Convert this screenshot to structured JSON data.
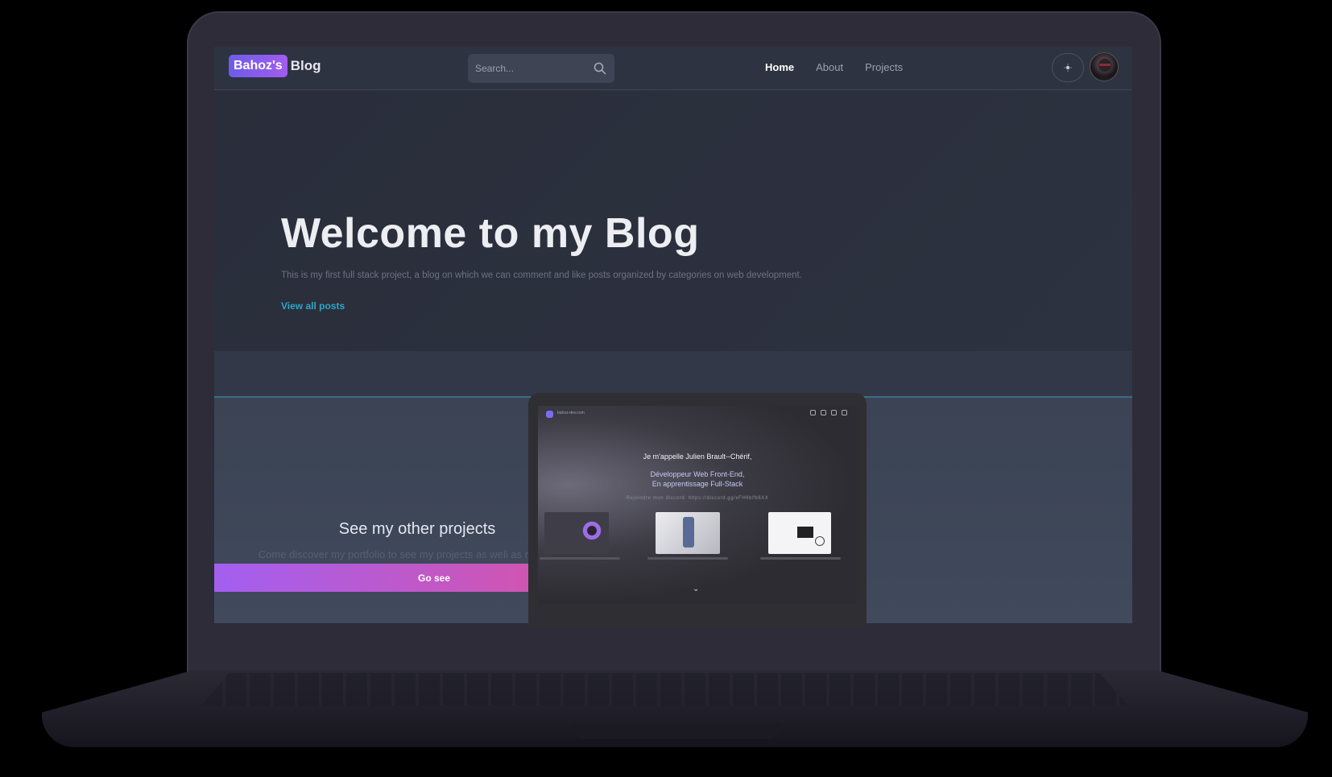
{
  "brand": {
    "badge": "Bahoz's",
    "text": "Blog"
  },
  "search": {
    "placeholder": "Search..."
  },
  "nav": {
    "items": [
      {
        "label": "Home"
      },
      {
        "label": "About"
      },
      {
        "label": "Projects"
      }
    ]
  },
  "hero": {
    "title": "Welcome to my Blog",
    "description": "This is my first full stack project, a blog on which we can comment and like posts organized by categories on web development.",
    "link": "View all posts"
  },
  "projects": {
    "title": "See my other projects",
    "description": "Come discover my portfolio to see my projects as well as my journey",
    "button": "Go see"
  },
  "preview": {
    "site_name": "bahoz-dev.com",
    "line1": "Je m'appelle Julien Brault--Chérif,",
    "line2": "Développeur Web Front-End,",
    "line3": "En apprentissage Full-Stack",
    "discord": "Rejoindre mon discord: https://discord.gg/xFH6bfN6XX"
  },
  "colors": {
    "accent": "#2fa6c6",
    "brand_gradient_start": "#a35ff0",
    "brand_gradient_end": "#e1519a"
  }
}
